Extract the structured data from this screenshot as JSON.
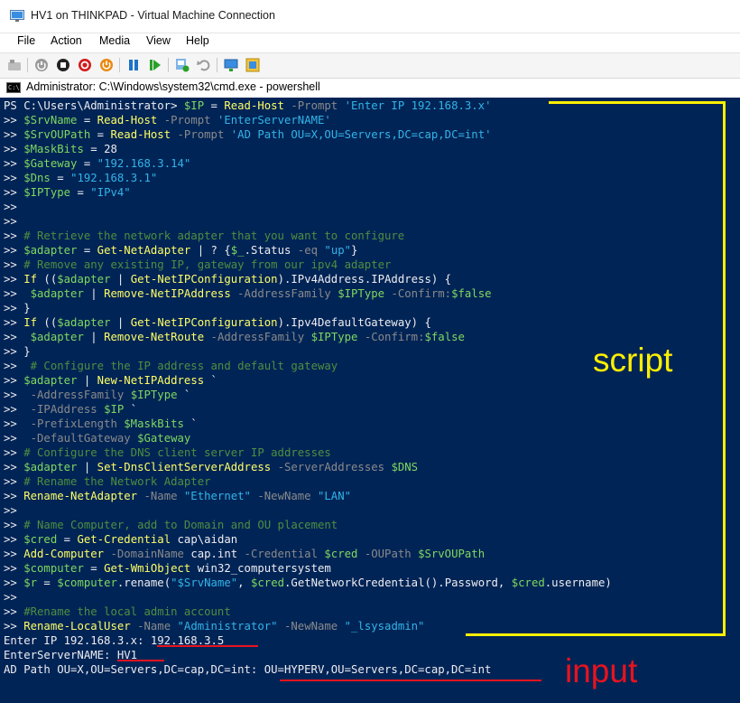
{
  "window": {
    "title": "HV1 on THINKPAD - Virtual Machine Connection"
  },
  "menu": [
    "File",
    "Action",
    "Media",
    "View",
    "Help"
  ],
  "toolbar": {
    "icons": [
      "ctrl-alt-del-icon",
      "start-icon",
      "turn-off-icon",
      "shut-down-icon",
      "power-icon",
      "pause-icon",
      "resume-icon",
      "checkpoint-icon",
      "revert-icon",
      "enhanced-session-icon",
      "zoom-icon"
    ]
  },
  "console": {
    "title": "Administrator: C:\\Windows\\system32\\cmd.exe - powershell",
    "background": "#012456",
    "lines": [
      [
        [
          "PS C:\\Users\\Administrator> ",
          "def"
        ],
        [
          "$IP",
          "var"
        ],
        [
          " = ",
          "def"
        ],
        [
          "Read-Host",
          "cmd"
        ],
        [
          " -Prompt ",
          "prm"
        ],
        [
          "'Enter IP 192.168.3.x'",
          "str"
        ]
      ],
      [
        [
          ">> ",
          "def"
        ],
        [
          "$SrvName",
          "var"
        ],
        [
          " = ",
          "def"
        ],
        [
          "Read-Host",
          "cmd"
        ],
        [
          " -Prompt ",
          "prm"
        ],
        [
          "'EnterServerNAME'",
          "str"
        ]
      ],
      [
        [
          ">> ",
          "def"
        ],
        [
          "$SrvOUPath",
          "var"
        ],
        [
          " = ",
          "def"
        ],
        [
          "Read-Host",
          "cmd"
        ],
        [
          " -Prompt ",
          "prm"
        ],
        [
          "'AD Path OU=X,OU=Servers,DC=cap,DC=int'",
          "str"
        ]
      ],
      [
        [
          ">> ",
          "def"
        ],
        [
          "$MaskBits",
          "var"
        ],
        [
          " = 28",
          "def"
        ]
      ],
      [
        [
          ">> ",
          "def"
        ],
        [
          "$Gateway",
          "var"
        ],
        [
          " = ",
          "def"
        ],
        [
          "\"192.168.3.14\"",
          "str"
        ]
      ],
      [
        [
          ">> ",
          "def"
        ],
        [
          "$Dns",
          "var"
        ],
        [
          " = ",
          "def"
        ],
        [
          "\"192.168.3.1\"",
          "str"
        ]
      ],
      [
        [
          ">> ",
          "def"
        ],
        [
          "$IPType",
          "var"
        ],
        [
          " = ",
          "def"
        ],
        [
          "\"IPv4\"",
          "str"
        ]
      ],
      [
        [
          ">>",
          "def"
        ]
      ],
      [
        [
          ">>",
          "def"
        ]
      ],
      [
        [
          ">> ",
          "def"
        ],
        [
          "# Retrieve the network adapter that you want to configure",
          "cmt"
        ]
      ],
      [
        [
          ">> ",
          "def"
        ],
        [
          "$adapter",
          "var"
        ],
        [
          " = ",
          "def"
        ],
        [
          "Get-NetAdapter",
          "cmd"
        ],
        [
          " | ? {",
          "def"
        ],
        [
          "$_",
          "var"
        ],
        [
          ".Status ",
          "def"
        ],
        [
          "-eq",
          "prm"
        ],
        [
          " ",
          "def"
        ],
        [
          "\"up\"",
          "str"
        ],
        [
          "}",
          "def"
        ]
      ],
      [
        [
          ">> ",
          "def"
        ],
        [
          "# Remove any existing IP, gateway from our ipv4 adapter",
          "cmt"
        ]
      ],
      [
        [
          ">> ",
          "def"
        ],
        [
          "If",
          "cmd"
        ],
        [
          " ((",
          "def"
        ],
        [
          "$adapter",
          "var"
        ],
        [
          " | ",
          "def"
        ],
        [
          "Get-NetIPConfiguration",
          "cmd"
        ],
        [
          ").IPv4Address.IPAddress) {",
          "def"
        ]
      ],
      [
        [
          ">>  ",
          "def"
        ],
        [
          "$adapter",
          "var"
        ],
        [
          " | ",
          "def"
        ],
        [
          "Remove-NetIPAddress",
          "cmd"
        ],
        [
          " -AddressFamily ",
          "prm"
        ],
        [
          "$IPType",
          "var"
        ],
        [
          " -Confirm:",
          "prm"
        ],
        [
          "$false",
          "var"
        ]
      ],
      [
        [
          ">> }",
          "def"
        ]
      ],
      [
        [
          ">> ",
          "def"
        ],
        [
          "If",
          "cmd"
        ],
        [
          " ((",
          "def"
        ],
        [
          "$adapter",
          "var"
        ],
        [
          " | ",
          "def"
        ],
        [
          "Get-NetIPConfiguration",
          "cmd"
        ],
        [
          ").Ipv4DefaultGateway) {",
          "def"
        ]
      ],
      [
        [
          ">>  ",
          "def"
        ],
        [
          "$adapter",
          "var"
        ],
        [
          " | ",
          "def"
        ],
        [
          "Remove-NetRoute",
          "cmd"
        ],
        [
          " -AddressFamily ",
          "prm"
        ],
        [
          "$IPType",
          "var"
        ],
        [
          " -Confirm:",
          "prm"
        ],
        [
          "$false",
          "var"
        ]
      ],
      [
        [
          ">> }",
          "def"
        ]
      ],
      [
        [
          ">>  ",
          "def"
        ],
        [
          "# Configure the IP address and default gateway",
          "cmt"
        ]
      ],
      [
        [
          ">> ",
          "def"
        ],
        [
          "$adapter",
          "var"
        ],
        [
          " | ",
          "def"
        ],
        [
          "New-NetIPAddress",
          "cmd"
        ],
        [
          " `",
          "def"
        ]
      ],
      [
        [
          ">>  ",
          "def"
        ],
        [
          "-AddressFamily ",
          "prm"
        ],
        [
          "$IPType",
          "var"
        ],
        [
          " `",
          "def"
        ]
      ],
      [
        [
          ">>  ",
          "def"
        ],
        [
          "-IPAddress ",
          "prm"
        ],
        [
          "$IP",
          "var"
        ],
        [
          " `",
          "def"
        ]
      ],
      [
        [
          ">>  ",
          "def"
        ],
        [
          "-PrefixLength ",
          "prm"
        ],
        [
          "$MaskBits",
          "var"
        ],
        [
          " `",
          "def"
        ]
      ],
      [
        [
          ">>  ",
          "def"
        ],
        [
          "-DefaultGateway ",
          "prm"
        ],
        [
          "$Gateway",
          "var"
        ]
      ],
      [
        [
          ">> ",
          "def"
        ],
        [
          "# Configure the DNS client server IP addresses",
          "cmt"
        ]
      ],
      [
        [
          ">> ",
          "def"
        ],
        [
          "$adapter",
          "var"
        ],
        [
          " | ",
          "def"
        ],
        [
          "Set-DnsClientServerAddress",
          "cmd"
        ],
        [
          " -ServerAddresses ",
          "prm"
        ],
        [
          "$DNS",
          "var"
        ]
      ],
      [
        [
          ">> ",
          "def"
        ],
        [
          "# Rename the Network Adapter",
          "cmt"
        ]
      ],
      [
        [
          ">> ",
          "def"
        ],
        [
          "Rename-NetAdapter",
          "cmd"
        ],
        [
          " -Name ",
          "prm"
        ],
        [
          "\"Ethernet\"",
          "str"
        ],
        [
          " -NewName ",
          "prm"
        ],
        [
          "\"LAN\"",
          "str"
        ]
      ],
      [
        [
          ">>",
          "def"
        ]
      ],
      [
        [
          ">> ",
          "def"
        ],
        [
          "# Name Computer, add to Domain and OU placement",
          "cmt"
        ]
      ],
      [
        [
          ">> ",
          "def"
        ],
        [
          "$cred",
          "var"
        ],
        [
          " = ",
          "def"
        ],
        [
          "Get-Credential",
          "cmd"
        ],
        [
          " cap\\aidan",
          "def"
        ]
      ],
      [
        [
          ">> ",
          "def"
        ],
        [
          "Add-Computer",
          "cmd"
        ],
        [
          " -DomainName ",
          "prm"
        ],
        [
          "cap.int",
          "def"
        ],
        [
          " -Credential ",
          "prm"
        ],
        [
          "$cred",
          "var"
        ],
        [
          " -OUPath ",
          "prm"
        ],
        [
          "$SrvOUPath",
          "var"
        ]
      ],
      [
        [
          ">> ",
          "def"
        ],
        [
          "$computer",
          "var"
        ],
        [
          " = ",
          "def"
        ],
        [
          "Get-WmiObject",
          "cmd"
        ],
        [
          " win32_computersystem",
          "def"
        ]
      ],
      [
        [
          ">> ",
          "def"
        ],
        [
          "$r",
          "var"
        ],
        [
          " = ",
          "def"
        ],
        [
          "$computer",
          "var"
        ],
        [
          ".rename(",
          "def"
        ],
        [
          "\"$SrvName\"",
          "str"
        ],
        [
          ", ",
          "def"
        ],
        [
          "$cred",
          "var"
        ],
        [
          ".GetNetworkCredential().Password, ",
          "def"
        ],
        [
          "$cred",
          "var"
        ],
        [
          ".username)",
          "def"
        ]
      ],
      [
        [
          ">>",
          "def"
        ]
      ],
      [
        [
          ">> ",
          "def"
        ],
        [
          "#Rename the local admin account",
          "cmt"
        ]
      ],
      [
        [
          ">> ",
          "def"
        ],
        [
          "Rename-LocalUser",
          "cmd"
        ],
        [
          " -Name ",
          "prm"
        ],
        [
          "\"Administrator\"",
          "str"
        ],
        [
          " -NewName ",
          "prm"
        ],
        [
          "\"_lsysadmin\"",
          "str"
        ]
      ],
      [
        [
          "Enter IP 192.168.3.x: 192.168.3.5",
          "def"
        ]
      ],
      [
        [
          "EnterServerNAME: HV1",
          "def"
        ]
      ],
      [
        [
          "AD Path OU=X,OU=Servers,DC=cap,DC=int: OU=HYPERV,OU=Servers,DC=cap,DC=int",
          "def"
        ]
      ]
    ]
  },
  "annotations": {
    "script_label": "script",
    "input_label": "input",
    "script_color": "#ffef00",
    "input_color": "#e8131e"
  }
}
